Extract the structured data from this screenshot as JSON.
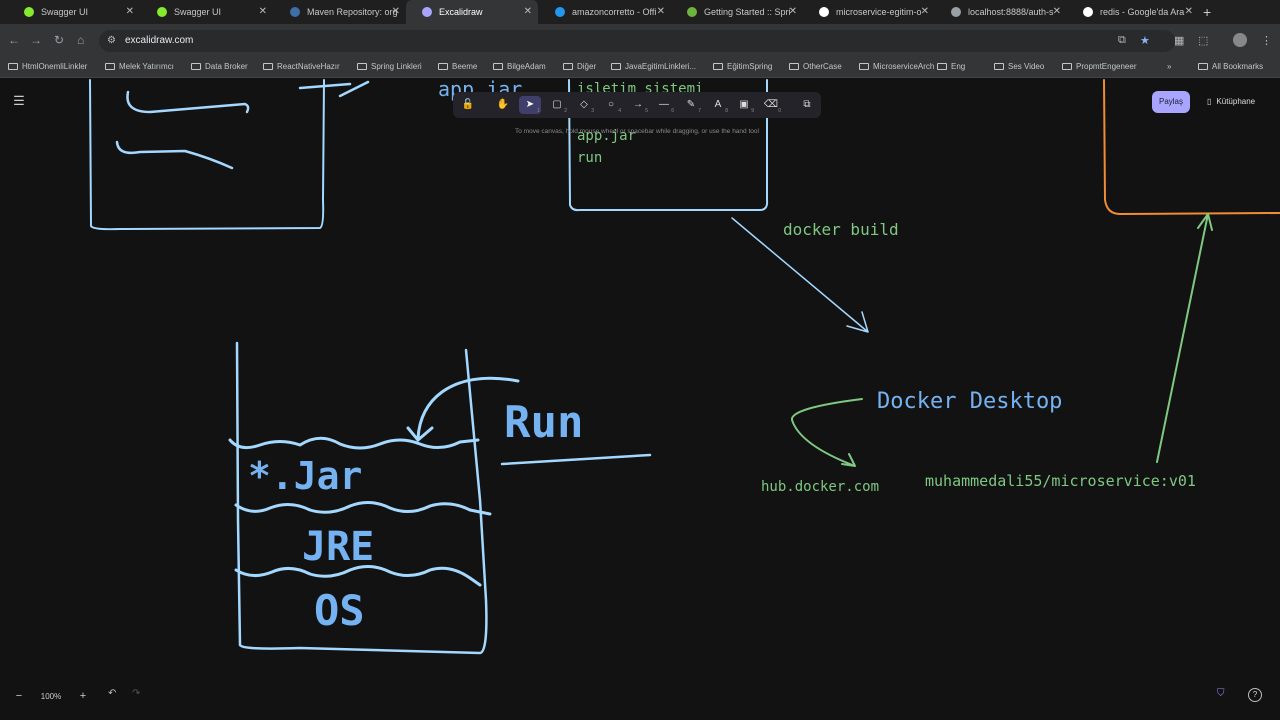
{
  "browser": {
    "tabs": [
      {
        "title": "Swagger UI",
        "icon": "swagger-icon",
        "color": "#85ea2d",
        "active": false
      },
      {
        "title": "Swagger UI",
        "icon": "swagger-icon",
        "color": "#85ea2d",
        "active": false
      },
      {
        "title": "Maven Repository: org",
        "icon": "maven-icon",
        "color": "#3d6fa8",
        "active": false
      },
      {
        "title": "Excalidraw",
        "icon": "excalidraw-icon",
        "color": "#a8a5ff",
        "active": true
      },
      {
        "title": "amazoncorretto - Offi",
        "icon": "docker-icon",
        "color": "#2496ed",
        "active": false
      },
      {
        "title": "Getting Started :: Spri",
        "icon": "spring-icon",
        "color": "#6db33f",
        "active": false
      },
      {
        "title": "microservice-egitim-o",
        "icon": "github-icon",
        "color": "#ffffff",
        "active": false
      },
      {
        "title": "localhost:8888/auth-s",
        "icon": "globe-icon",
        "color": "#9aa0a6",
        "active": false
      },
      {
        "title": "redis - Google'da Ara",
        "icon": "google-icon",
        "color": "#ffffff",
        "active": false
      }
    ],
    "url": "excalidraw.com",
    "bookmarks": [
      "HtmlOnemliLinkler",
      "Melek Yatırımcı",
      "Data Broker",
      "ReactNativeHazır",
      "Spring Linkleri",
      "Beeme",
      "BilgeAdam",
      "Diğer",
      "JavaEgitimLinkleri...",
      "EğitimSpring",
      "OtherCase",
      "MicroserviceArch",
      "Eng",
      "Ses Video",
      "PropmtEngeneer"
    ],
    "all_bookmarks": "All Bookmarks",
    "more_bookmarks": "»"
  },
  "excalidraw": {
    "toolbar_hint": "To move canvas, hold mouse wheel or spacebar while dragging, or use the hand tool",
    "tools": [
      {
        "icon": "lock-icon",
        "glyph": "🔓",
        "key": ""
      },
      {
        "icon": "hand-icon",
        "glyph": "✋",
        "key": ""
      },
      {
        "icon": "selection-icon",
        "glyph": "➤",
        "key": "1"
      },
      {
        "icon": "rectangle-icon",
        "glyph": "▢",
        "key": "2"
      },
      {
        "icon": "diamond-icon",
        "glyph": "◇",
        "key": "3"
      },
      {
        "icon": "ellipse-icon",
        "glyph": "○",
        "key": "4"
      },
      {
        "icon": "arrow-icon",
        "glyph": "→",
        "key": "5"
      },
      {
        "icon": "line-icon",
        "glyph": "—",
        "key": "6"
      },
      {
        "icon": "pencil-icon",
        "glyph": "✎",
        "key": "7"
      },
      {
        "icon": "text-icon",
        "glyph": "A",
        "key": "8"
      },
      {
        "icon": "image-icon",
        "glyph": "▣",
        "key": "9"
      },
      {
        "icon": "eraser-icon",
        "glyph": "⌫",
        "key": "0"
      },
      {
        "icon": "extra-tools-icon",
        "glyph": "⧉",
        "key": ""
      }
    ],
    "share_label": "Paylaş",
    "library_label": "Kütüphane",
    "zoom_level": "100%",
    "canvas_text": {
      "app_jar_top": "app.jar",
      "isletim_sistemi": "işletim sistemi",
      "app_jar": "app.jar",
      "run_small": "run",
      "docker_build": "docker build",
      "docker_desktop": "Docker Desktop",
      "hub_docker": "hub.docker.com",
      "image_name": "muhammedali55/microservice:v01",
      "jar": "*.Jar",
      "jre": "JRE",
      "os": "OS",
      "run_big": "Run"
    }
  },
  "colors": {
    "blue_stroke": "#a5d8ff",
    "blue_text": "#74b2f2",
    "green": "#7ec882",
    "orange": "#f08c36",
    "canvas_bg": "#121212"
  }
}
